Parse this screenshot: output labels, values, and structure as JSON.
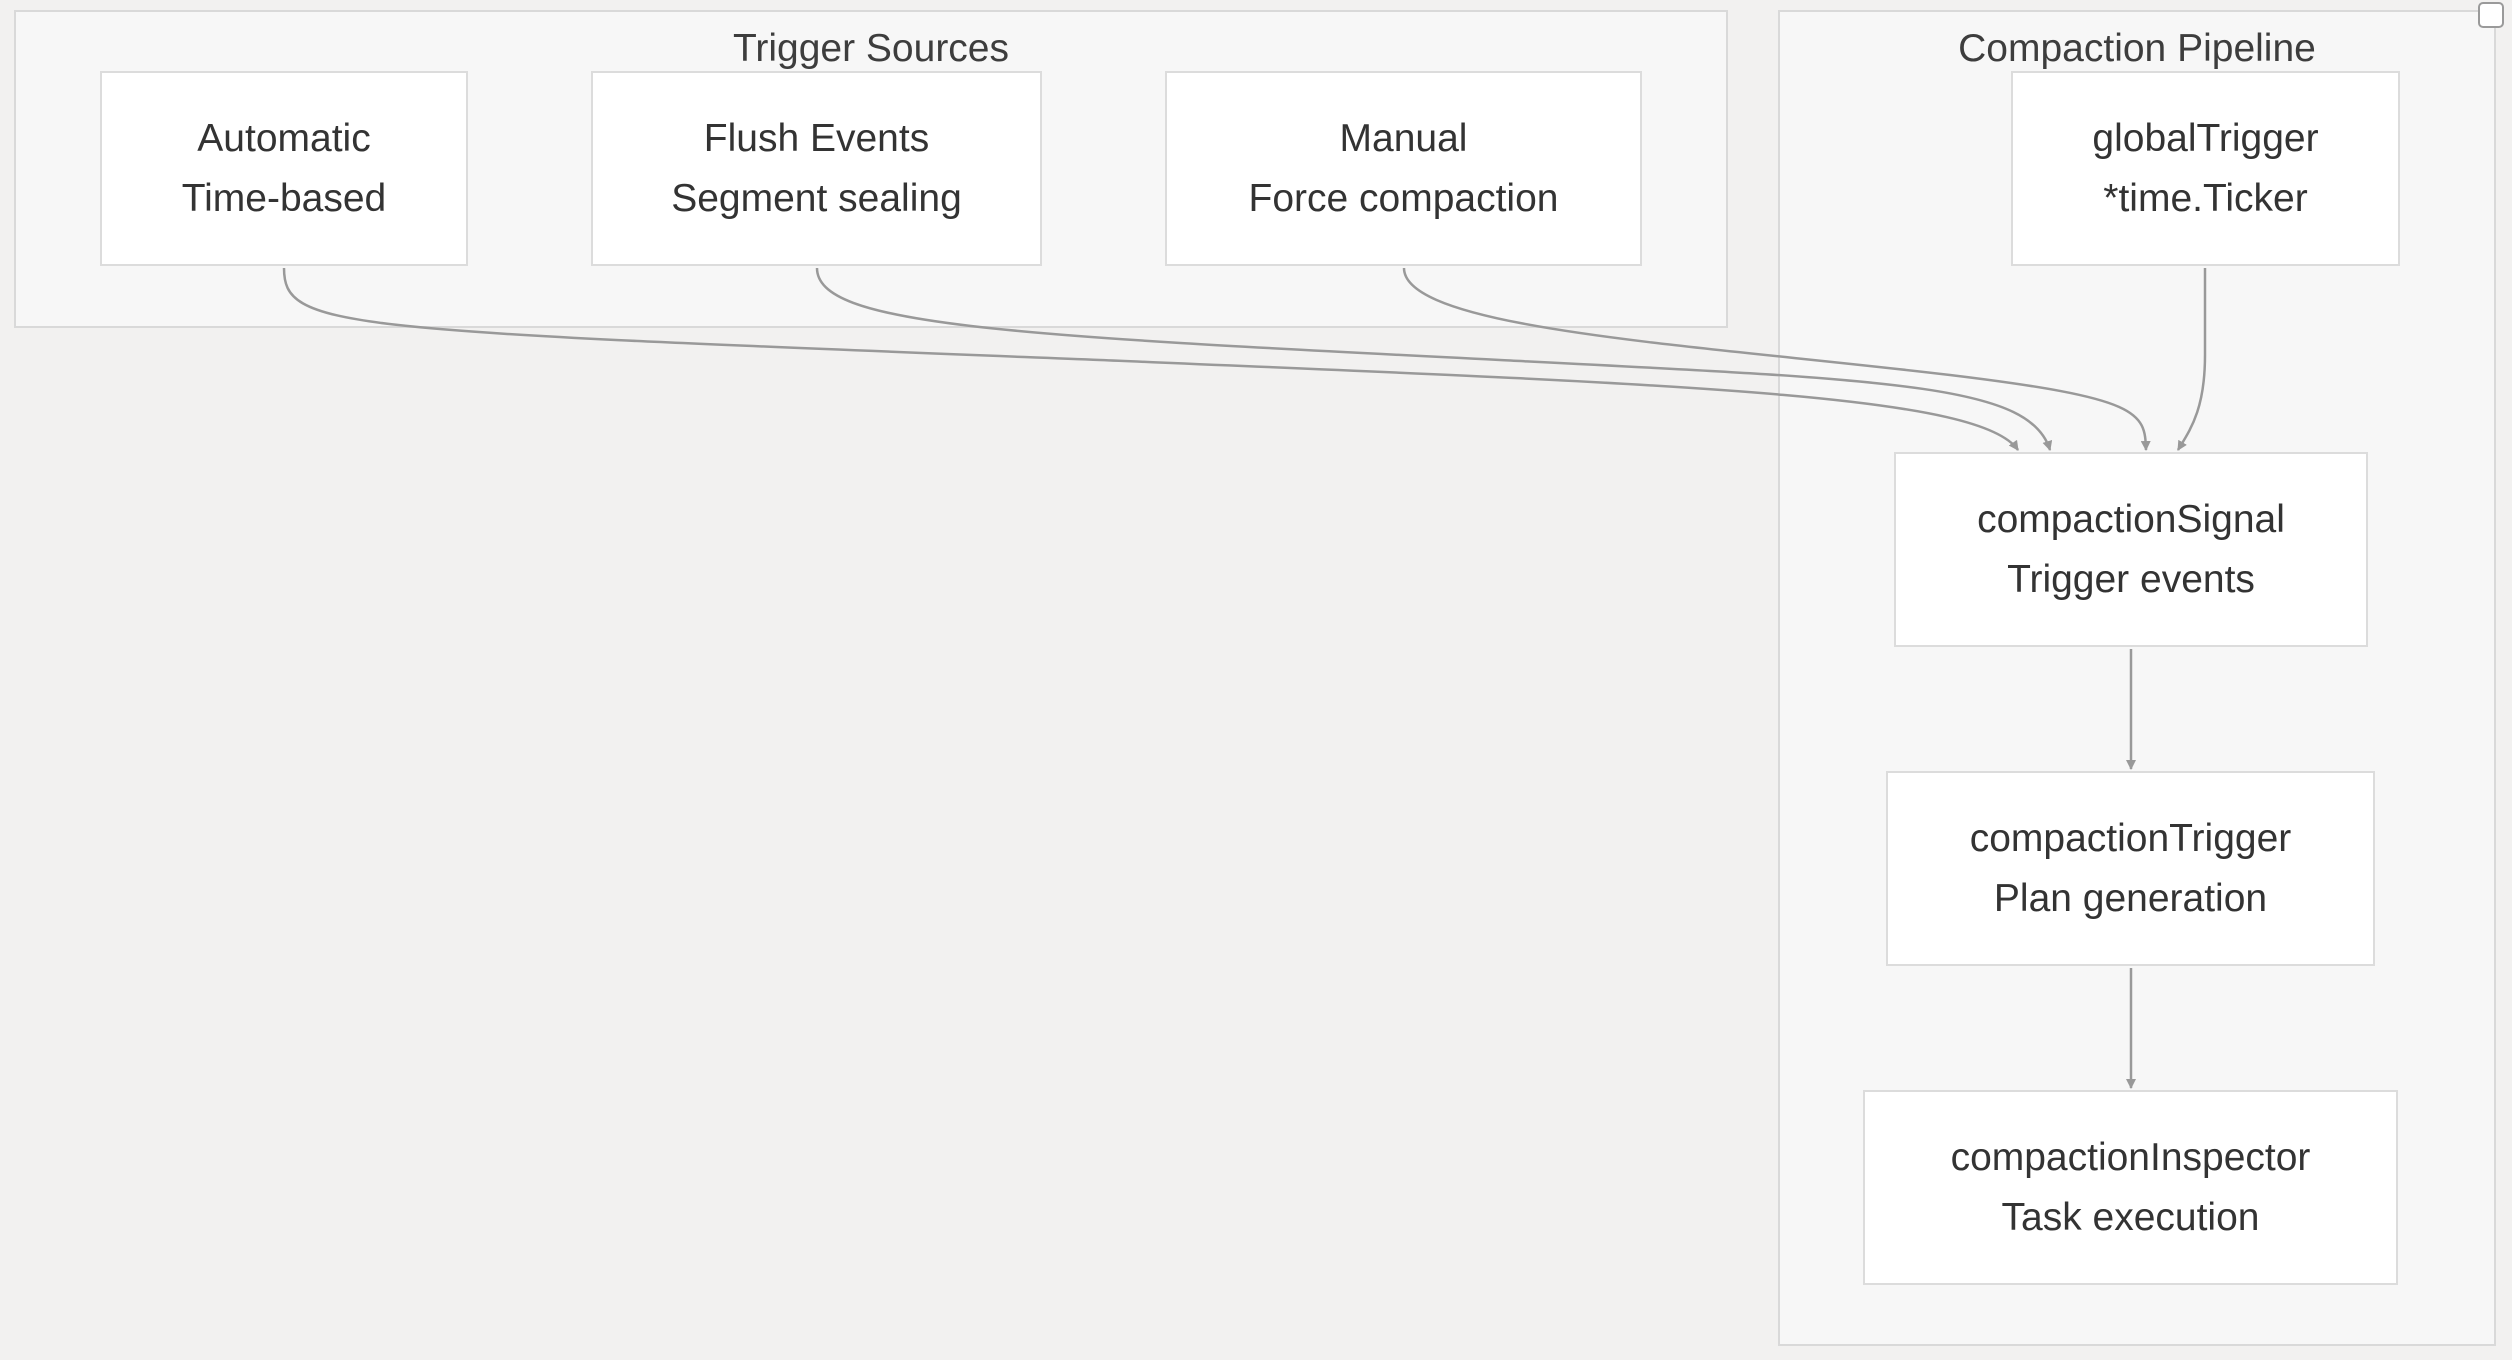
{
  "clusters": {
    "trigger_sources": {
      "title": "Trigger Sources"
    },
    "compaction_pipeline": {
      "title": "Compaction Pipeline"
    }
  },
  "nodes": {
    "automatic": {
      "line1": "Automatic",
      "line2": "Time-based"
    },
    "flush_events": {
      "line1": "Flush Events",
      "line2": "Segment sealing"
    },
    "manual": {
      "line1": "Manual",
      "line2": "Force compaction"
    },
    "global_trigger": {
      "line1": "globalTrigger",
      "line2": "*time.Ticker"
    },
    "compaction_signal": {
      "line1": "compactionSignal",
      "line2": "Trigger events"
    },
    "compaction_trigger": {
      "line1": "compactionTrigger",
      "line2": "Plan generation"
    },
    "compaction_inspector": {
      "line1": "compactionInspector",
      "line2": "Task execution"
    }
  },
  "edges": [
    {
      "from": "automatic",
      "to": "compaction_signal"
    },
    {
      "from": "flush_events",
      "to": "compaction_signal"
    },
    {
      "from": "manual",
      "to": "compaction_signal"
    },
    {
      "from": "global_trigger",
      "to": "compaction_signal"
    },
    {
      "from": "compaction_signal",
      "to": "compaction_trigger"
    },
    {
      "from": "compaction_trigger",
      "to": "compaction_inspector"
    }
  ],
  "colors": {
    "edge": "#999999",
    "node_border": "#dcdcdc",
    "cluster_fill": "#f7f7f7",
    "background": "#f2f1f0"
  }
}
